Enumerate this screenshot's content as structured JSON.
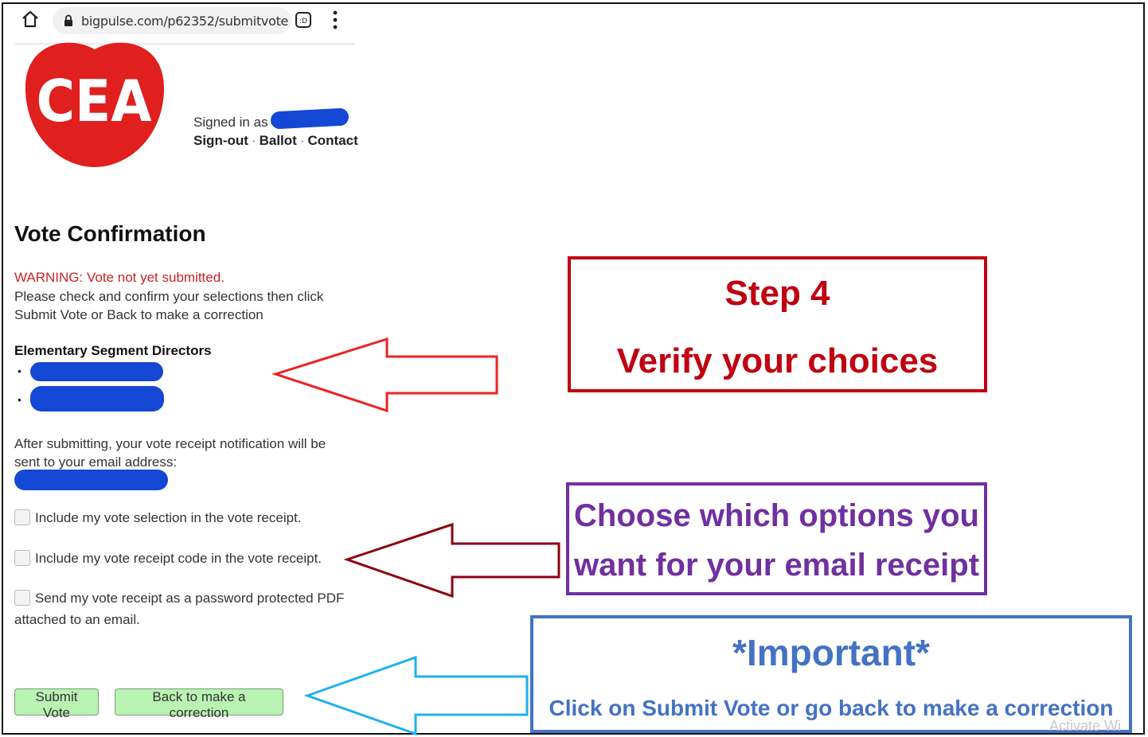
{
  "browser": {
    "url": "bigpulse.com/p62352/submitvote",
    "icons": [
      "home-icon",
      "lock-icon",
      "tab-switcher-icon",
      "overflow-menu-icon"
    ]
  },
  "header": {
    "logo_text": "CEA",
    "signed_in_label": "Signed in as",
    "links": {
      "signout": "Sign-out",
      "ballot": "Ballot",
      "contact": "Contact"
    },
    "separator": "·"
  },
  "main": {
    "title": "Vote Confirmation",
    "warning": "WARNING: Vote not yet submitted.",
    "instructions": "Please check and confirm your selections then click Submit Vote or Back to make a correction",
    "segment_heading": "Elementary Segment Directors",
    "bullet": "•",
    "receipt_note": "After submitting, your vote receipt notification will be sent to your email address:",
    "options": [
      {
        "label": "Include my vote selection in the vote receipt.",
        "checked": false
      },
      {
        "label": "Include my vote receipt code in the vote receipt.",
        "checked": false
      },
      {
        "label": "Send my vote receipt as a password protected PDF attached to an email.",
        "checked": false
      }
    ],
    "buttons": {
      "submit": "Submit Vote",
      "back": "Back to make a correction"
    }
  },
  "annotations": {
    "step": {
      "line1": "Step 4",
      "line2": "Verify your choices",
      "color": "#c00010"
    },
    "receipt": {
      "line1": "Choose which options you",
      "line2": "want for your email receipt",
      "color": "#7030a0"
    },
    "important": {
      "line1": "*Important*",
      "line2": "Click on Submit Vote or go back to make a correction",
      "color": "#4472c4"
    },
    "arrow_colors": {
      "step": "#ee2222",
      "receipt": "#8b0010",
      "important": "#1fb0f0"
    }
  },
  "watermark": "Activate Wi",
  "colors": {
    "redaction": "#1447d4",
    "logo_red": "#e01f1f",
    "button_green": "#b9f2b3",
    "warning_red": "#cc2222"
  }
}
